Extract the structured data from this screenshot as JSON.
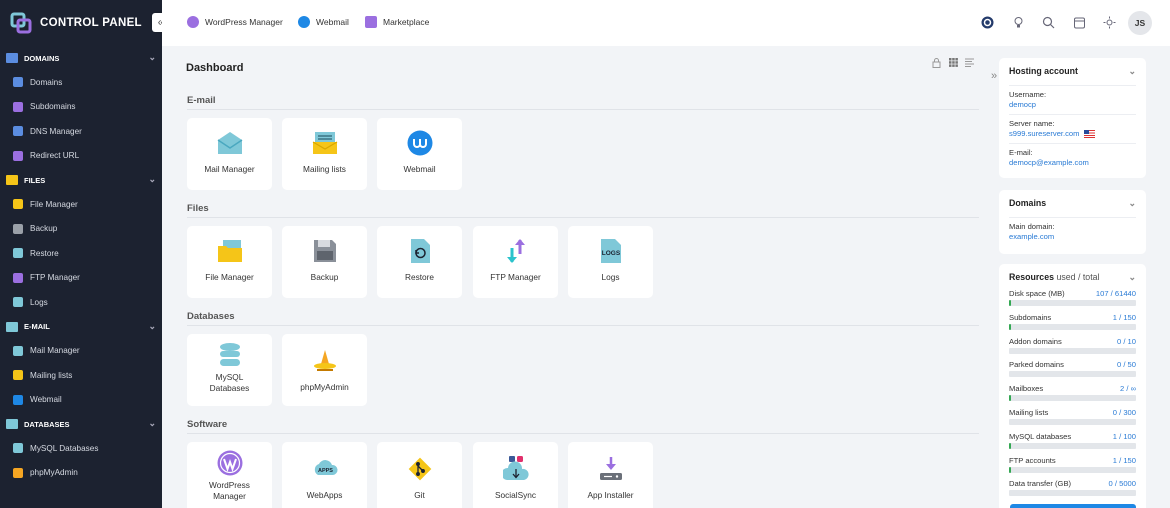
{
  "app": {
    "title": "CONTROL PANEL",
    "collapse_glyph": "«"
  },
  "sidebar": {
    "sections": [
      {
        "title": "DOMAINS",
        "color": "#5b8de0",
        "items": [
          {
            "label": "Domains",
            "icon": "domains-icon",
            "color": "#5b8de0"
          },
          {
            "label": "Subdomains",
            "icon": "subdomains-icon",
            "color": "#9b6fe0"
          },
          {
            "label": "DNS Manager",
            "icon": "dns-icon",
            "color": "#5b8de0"
          },
          {
            "label": "Redirect URL",
            "icon": "redirect-icon",
            "color": "#9b6fe0"
          }
        ]
      },
      {
        "title": "FILES",
        "color": "#f5c518",
        "items": [
          {
            "label": "File Manager",
            "icon": "folder-icon",
            "color": "#f5c518"
          },
          {
            "label": "Backup",
            "icon": "backup-icon",
            "color": "#9aa0a8"
          },
          {
            "label": "Restore",
            "icon": "restore-icon",
            "color": "#7fc8d8"
          },
          {
            "label": "FTP Manager",
            "icon": "ftp-icon",
            "color": "#9b6fe0"
          },
          {
            "label": "Logs",
            "icon": "logs-icon",
            "color": "#7fc8d8"
          }
        ]
      },
      {
        "title": "E-MAIL",
        "color": "#7fc8d8",
        "items": [
          {
            "label": "Mail Manager",
            "icon": "mail-icon",
            "color": "#7fc8d8"
          },
          {
            "label": "Mailing lists",
            "icon": "mailing-list-icon",
            "color": "#f5c518"
          },
          {
            "label": "Webmail",
            "icon": "webmail-icon",
            "color": "#1e88e5"
          }
        ]
      },
      {
        "title": "DATABASES",
        "color": "#7fc8d8",
        "items": [
          {
            "label": "MySQL Databases",
            "icon": "database-icon",
            "color": "#7fc8d8"
          },
          {
            "label": "phpMyAdmin",
            "icon": "phpmyadmin-icon",
            "color": "#f5a623"
          }
        ]
      }
    ]
  },
  "topbar": {
    "links": [
      {
        "label": "WordPress Manager",
        "icon": "wordpress-icon",
        "color": "#9b6fe0"
      },
      {
        "label": "Webmail",
        "icon": "webmail-icon",
        "color": "#1e88e5"
      },
      {
        "label": "Marketplace",
        "icon": "cart-icon",
        "color": "#9b6fe0"
      }
    ],
    "icons": [
      "sync-icon",
      "lightbulb-icon",
      "search-icon",
      "calendar-icon",
      "sun-icon"
    ],
    "avatar": "JS"
  },
  "main": {
    "title": "Dashboard",
    "categories": [
      {
        "title": "E-mail",
        "tiles": [
          {
            "label": "Mail Manager",
            "icon": "mail-icon"
          },
          {
            "label": "Mailing lists",
            "icon": "mailing-list-icon"
          },
          {
            "label": "Webmail",
            "icon": "webmail-icon"
          }
        ]
      },
      {
        "title": "Files",
        "tiles": [
          {
            "label": "File Manager",
            "icon": "folder-icon"
          },
          {
            "label": "Backup",
            "icon": "backup-icon"
          },
          {
            "label": "Restore",
            "icon": "restore-icon"
          },
          {
            "label": "FTP Manager",
            "icon": "ftp-icon"
          },
          {
            "label": "Logs",
            "icon": "logs-icon",
            "icon_text": "LOGS"
          }
        ]
      },
      {
        "title": "Databases",
        "tiles": [
          {
            "label": "MySQL Databases",
            "icon": "database-icon"
          },
          {
            "label": "phpMyAdmin",
            "icon": "phpmyadmin-icon"
          }
        ]
      },
      {
        "title": "Software",
        "tiles": [
          {
            "label": "WordPress Manager",
            "icon": "wordpress-icon"
          },
          {
            "label": "WebApps",
            "icon": "webapps-icon",
            "icon_text": "APPS"
          },
          {
            "label": "Git",
            "icon": "git-icon"
          },
          {
            "label": "SocialSync",
            "icon": "socialsync-icon"
          },
          {
            "label": "App Installer",
            "icon": "app-installer-icon"
          }
        ]
      }
    ]
  },
  "panel": {
    "toggle_glyph": "»",
    "hosting": {
      "title": "Hosting account",
      "username_label": "Username:",
      "username": "democp",
      "server_label": "Server name:",
      "server": "s999.sureserver.com",
      "email_label": "E-mail:",
      "email": "democp@example.com"
    },
    "domains": {
      "title": "Domains",
      "main_label": "Main domain:",
      "main": "example.com"
    },
    "resources": {
      "title": "Resources",
      "subtitle": "used / total",
      "rows": [
        {
          "label": "Disk space (MB)",
          "value": "107 / 61440",
          "fraction": 0.002
        },
        {
          "label": "Subdomains",
          "value": "1 / 150",
          "fraction": 0.007
        },
        {
          "label": "Addon domains",
          "value": "0 / 10",
          "fraction": 0
        },
        {
          "label": "Parked domains",
          "value": "0 / 50",
          "fraction": 0
        },
        {
          "label": "Mailboxes",
          "value": "2 / ∞",
          "fraction": 0.01
        },
        {
          "label": "Mailing lists",
          "value": "0 / 300",
          "fraction": 0
        },
        {
          "label": "MySQL databases",
          "value": "1 / 100",
          "fraction": 0.01
        },
        {
          "label": "FTP accounts",
          "value": "1 / 150",
          "fraction": 0.007
        },
        {
          "label": "Data transfer (GB)",
          "value": "0 / 5000",
          "fraction": 0
        }
      ]
    }
  }
}
